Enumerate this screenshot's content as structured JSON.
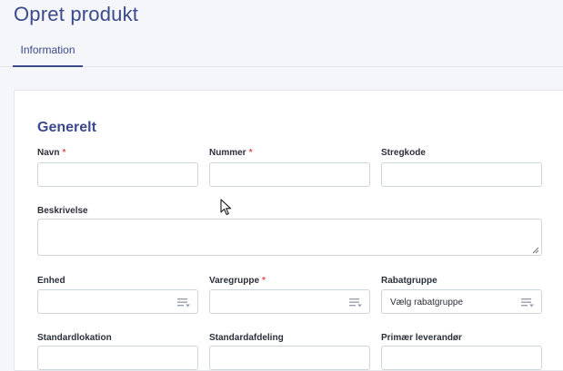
{
  "header": {
    "title": "Opret produkt"
  },
  "tabs": [
    {
      "label": "Information",
      "active": true
    }
  ],
  "form": {
    "section_title": "Generelt",
    "required_marker": "*",
    "fields": {
      "navn": {
        "label": "Navn",
        "required": true,
        "value": ""
      },
      "nummer": {
        "label": "Nummer",
        "required": true,
        "value": ""
      },
      "stregkode": {
        "label": "Stregkode",
        "required": false,
        "value": ""
      },
      "beskrivelse": {
        "label": "Beskrivelse",
        "required": false,
        "value": ""
      },
      "enhed": {
        "label": "Enhed",
        "required": false,
        "value": ""
      },
      "varegruppe": {
        "label": "Varegruppe",
        "required": true,
        "value": ""
      },
      "rabatgruppe": {
        "label": "Rabatgruppe",
        "required": false,
        "value": "Vælg rabatgruppe"
      },
      "standardlokation": {
        "label": "Standardlokation",
        "required": false
      },
      "standardafdeling": {
        "label": "Standardafdeling",
        "required": false
      },
      "primaer_leverandoer": {
        "label": "Primær leverandør",
        "required": false
      }
    }
  },
  "icons": {
    "select": "list-filter-icon",
    "cursor": "mouse-pointer-icon"
  },
  "colors": {
    "accent": "#3b4a8c",
    "required": "#d9534f",
    "border": "#cfd3dc",
    "background": "#f5f6f9"
  }
}
